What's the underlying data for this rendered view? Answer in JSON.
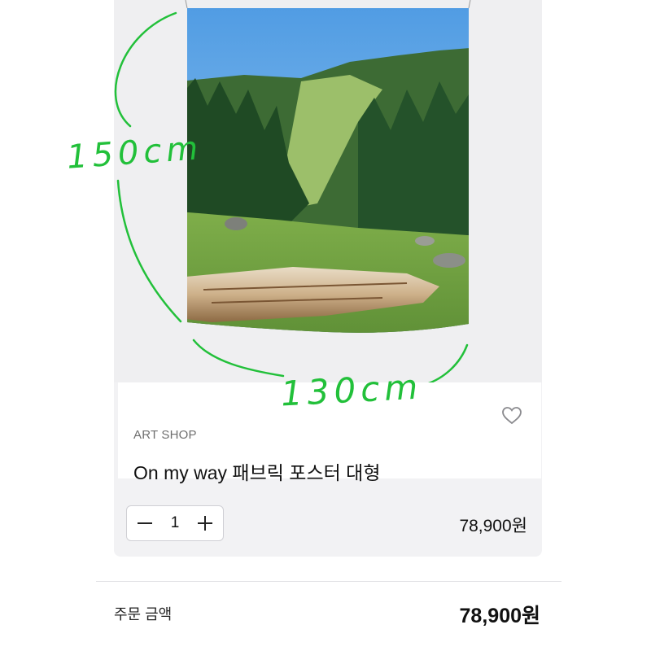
{
  "product": {
    "shop_name": "ART SHOP",
    "title": "On my way 패브릭 포스터 대형",
    "favorite_icon": "heart-outline",
    "image_subject": "fabric poster photo: green mountain meadow with pine trees and a fallen log"
  },
  "annotations": {
    "height_label": "150cm",
    "width_label": "130cm",
    "color": "#22c03a"
  },
  "quantity": {
    "minus_icon": "minus-icon",
    "value": "1",
    "plus_icon": "plus-icon"
  },
  "price": {
    "item_price": "78,900원"
  },
  "order": {
    "label": "주문 금액",
    "total": "78,900원"
  }
}
